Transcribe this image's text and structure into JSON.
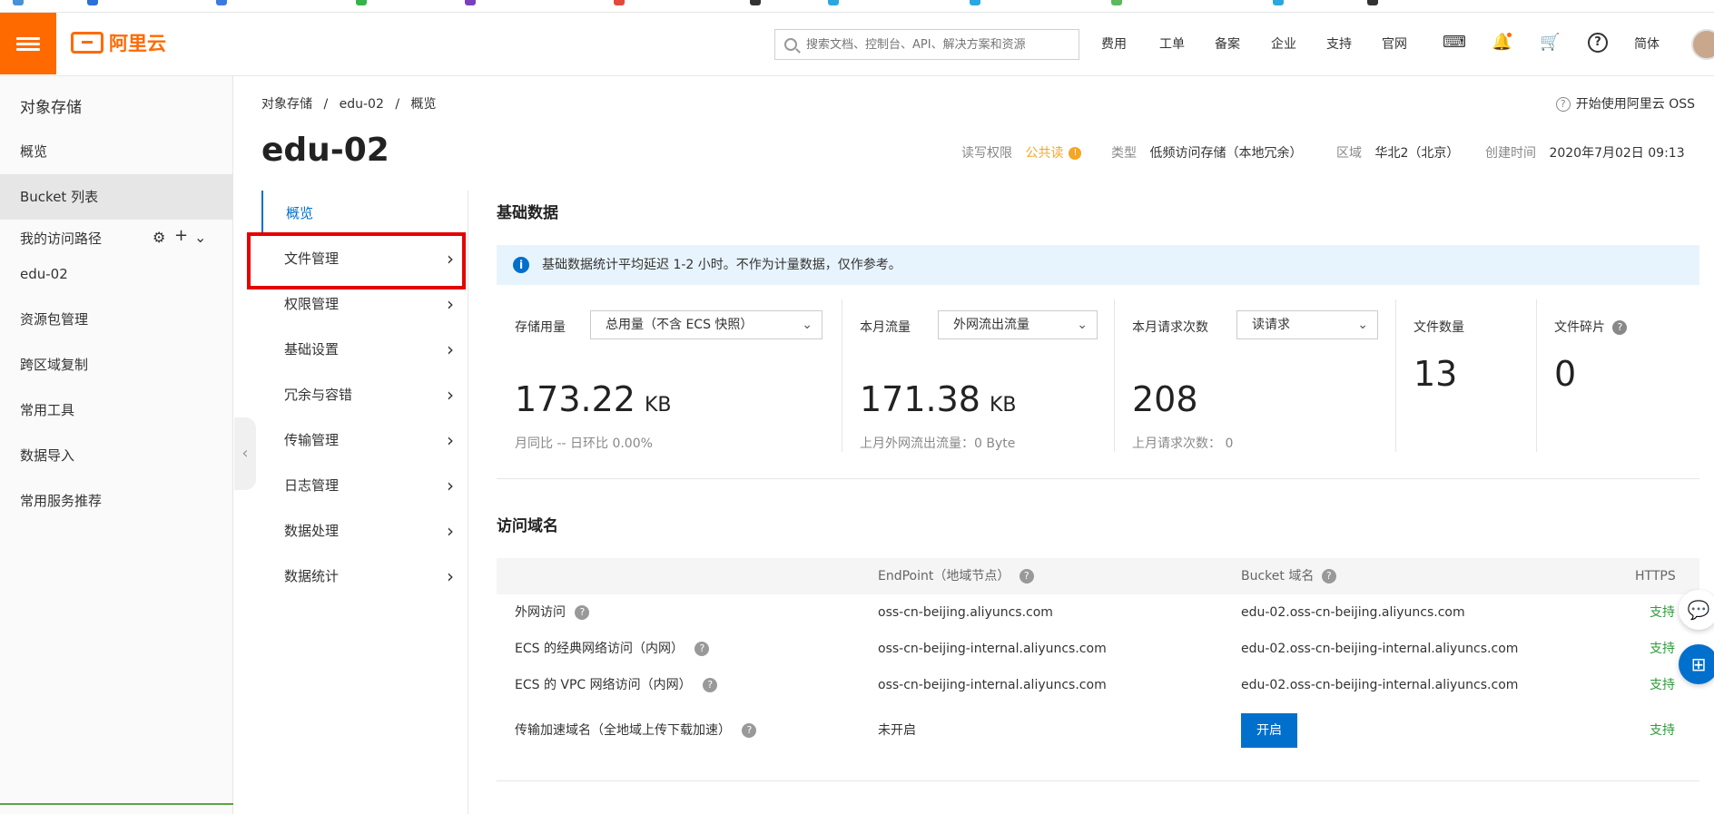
{
  "topbar": {
    "logo_text": "阿里云",
    "search_placeholder": "搜索文档、控制台、API、解决方案和资源",
    "nav": [
      "费用",
      "工单",
      "备案",
      "企业",
      "支持",
      "官网"
    ],
    "lang": "简体",
    "icons": [
      "terminal-icon",
      "bell-icon",
      "cart-icon",
      "help-icon"
    ]
  },
  "sidebar": {
    "title": "对象存储",
    "items": [
      "概览",
      "Bucket 列表"
    ],
    "path_label": "我的访问路径",
    "path_items": [
      "edu-02",
      "资源包管理",
      "跨区域复制",
      "常用工具",
      "数据导入",
      "常用服务推荐"
    ]
  },
  "breadcrumb": [
    "对象存储",
    "/",
    "edu-02",
    "/",
    "概览"
  ],
  "help_link": "开始使用阿里云 OSS",
  "bucket": {
    "name": "edu-02",
    "acl_label": "读写权限",
    "acl_value": "公共读",
    "type_label": "类型",
    "type_value": "低频访问存储（本地冗余）",
    "region_label": "区域",
    "region_value": "华北2（北京）",
    "created_label": "创建时间",
    "created_value": "2020年7月02日 09:13"
  },
  "subnav": [
    "概览",
    "文件管理",
    "权限管理",
    "基础设置",
    "冗余与容错",
    "传输管理",
    "日志管理",
    "数据处理",
    "数据统计"
  ],
  "basic": {
    "title": "基础数据",
    "notice": "基础数据统计平均延迟 1-2 小时。不作为计量数据，仅作参考。",
    "storage_label": "存储用量",
    "storage_select": "总用量（不含 ECS 快照）",
    "storage_value": "173.22",
    "storage_unit": "KB",
    "storage_sub": "月同比  --  日环比  0.00%",
    "traffic_label": "本月流量",
    "traffic_select": "外网流出流量",
    "traffic_value": "171.38",
    "traffic_unit": "KB",
    "traffic_sub": "上月外网流出流量：0 Byte",
    "req_label": "本月请求次数",
    "req_select": "读请求",
    "req_value": "208",
    "req_sub": "上月请求次数：  0",
    "files_label": "文件数量",
    "files_value": "13",
    "frag_label": "文件碎片",
    "frag_value": "0"
  },
  "domain": {
    "title": "访问域名",
    "headers": [
      "",
      "EndPoint（地域节点）",
      "Bucket 域名",
      "HTTPS"
    ],
    "rows": [
      {
        "name": "外网访问",
        "endpoint": "oss-cn-beijing.aliyuncs.com",
        "bucket": "edu-02.oss-cn-beijing.aliyuncs.com",
        "https": "支持"
      },
      {
        "name": "ECS 的经典网络访问（内网）",
        "endpoint": "oss-cn-beijing-internal.aliyuncs.com",
        "bucket": "edu-02.oss-cn-beijing-internal.aliyuncs.com",
        "https": "支持"
      },
      {
        "name": "ECS 的 VPC 网络访问（内网）",
        "endpoint": "oss-cn-beijing-internal.aliyuncs.com",
        "bucket": "edu-02.oss-cn-beijing-internal.aliyuncs.com",
        "https": "支持"
      },
      {
        "name": "传输加速域名（全地域上传下载加速）",
        "endpoint": "未开启",
        "bucket_button": "开启",
        "https": "支持"
      }
    ]
  },
  "colors": {
    "brand": "#ff6a00",
    "primary": "#0070cc",
    "highlight": "#e60000",
    "success": "#2e9a3a"
  }
}
